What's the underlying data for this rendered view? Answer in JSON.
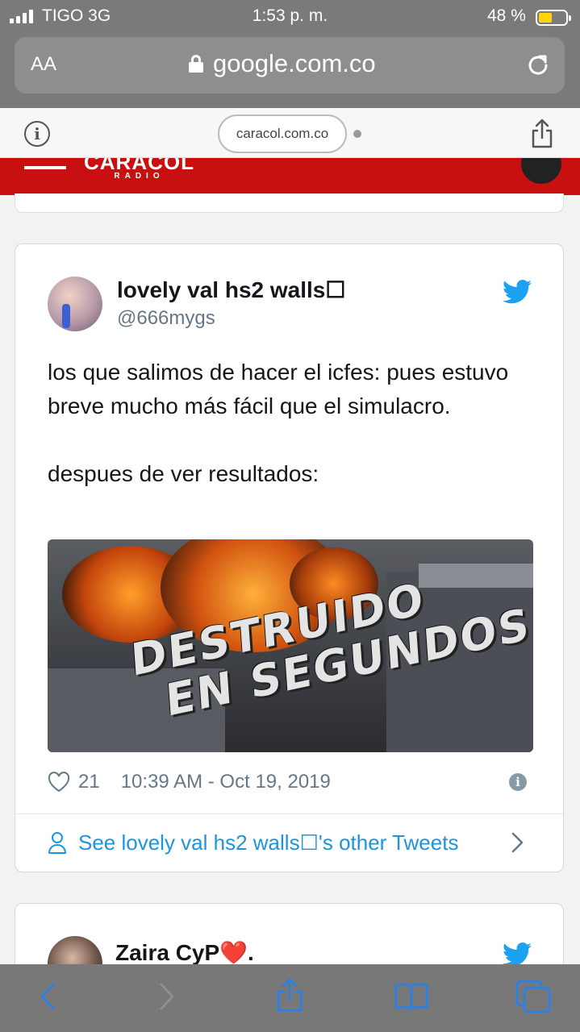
{
  "status_bar": {
    "carrier": "TIGO 3G",
    "time": "1:53 p. m.",
    "battery": "48 %",
    "battery_level": 0.48
  },
  "browser": {
    "text_size_label": "AA",
    "url_domain": "google.com.co",
    "site_chip": "caracol.com.co"
  },
  "site_header": {
    "logo_text": "CARACOL",
    "logo_sub": "RADIO",
    "brand_color": "#c81010"
  },
  "tweet": {
    "author_name": "lovely val hs2 walls☐",
    "author_handle": "@666mygs",
    "text": "los que salimos de hacer el icfes: pues estuvo breve mucho más fácil que el simulacro.\n\ndespues de ver resultados:",
    "media_caption_line1": "DESTRUIDO",
    "media_caption_line2": "EN SEGUNDOS",
    "likes": "21",
    "timestamp": "10:39 AM - Oct 19, 2019",
    "other_tweets_label": "See lovely val hs2 walls☐'s other Tweets",
    "accent_color": "#1b95e0"
  },
  "next_tweet": {
    "author_name": "Zaira CyP",
    "name_suffix_emoji": "❤️",
    "name_trailing": "."
  },
  "icons": [
    "signal-icon",
    "battery-icon",
    "lock-icon",
    "reload-icon",
    "info-icon",
    "share-icon",
    "menu-icon",
    "twitter-bird-icon",
    "heart-icon",
    "info-small-icon",
    "person-icon",
    "chevron-right-icon",
    "back-icon",
    "forward-icon",
    "bookmarks-icon",
    "tabs-icon"
  ]
}
